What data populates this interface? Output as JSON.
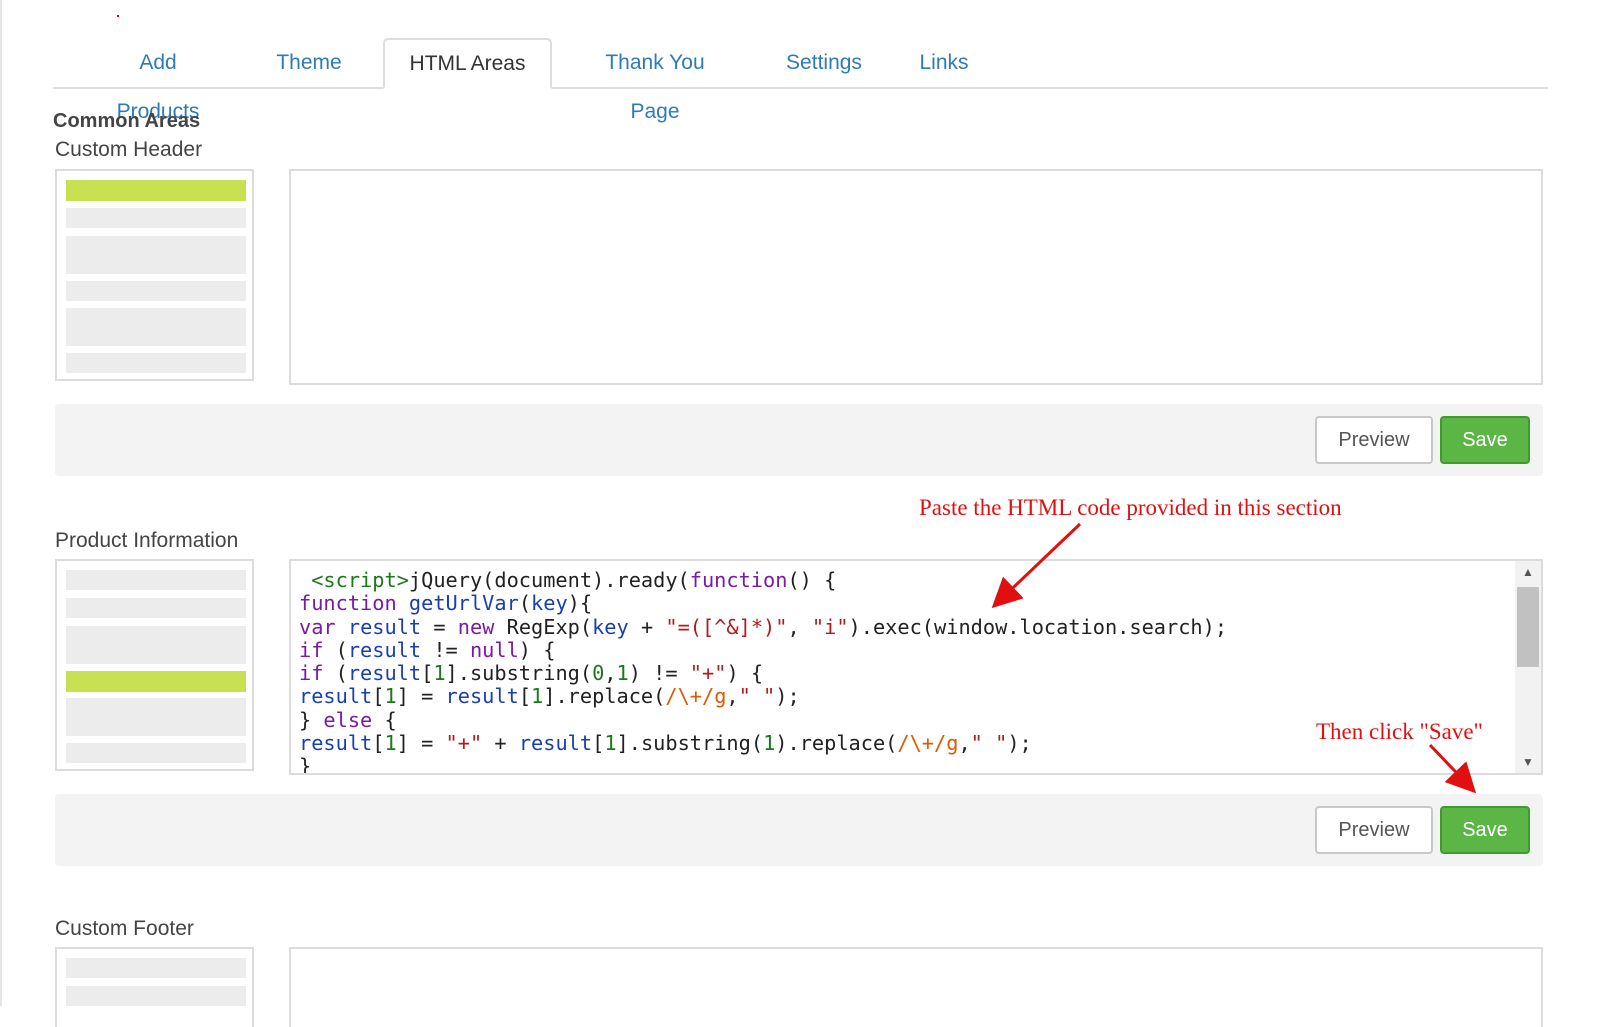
{
  "tabs": [
    {
      "label": "Add Products",
      "active": false
    },
    {
      "label": "Theme",
      "active": false
    },
    {
      "label": "HTML Areas",
      "active": true
    },
    {
      "label": "Thank You Page",
      "active": false
    },
    {
      "label": "Settings",
      "active": false
    },
    {
      "label": "Links",
      "active": false
    }
  ],
  "common_areas": {
    "heading": "Common Areas"
  },
  "custom_header": {
    "label": "Custom Header",
    "editor_value": "",
    "preview_label": "Preview",
    "save_label": "Save"
  },
  "product_information": {
    "label": "Product Information",
    "editor_lines": [
      " <script>jQuery(document).ready(function() {",
      "function getUrlVar(key){",
      "var result = new RegExp(key + \"=([^&]*)\", \"i\").exec(window.location.search);",
      "if (result != null) {",
      "if (result[1].substring(0,1) != \"+\") {",
      "result[1] = result[1].replace(/\\+/g,\" \");",
      "} else {",
      "result[1] = \"+\" + result[1].substring(1).replace(/\\+/g,\" \");",
      "}"
    ],
    "preview_label": "Preview",
    "save_label": "Save"
  },
  "custom_footer": {
    "label": "Custom Footer",
    "editor_value": ""
  },
  "annotations": {
    "paste": "Paste the HTML code provided in this section",
    "save": "Then click \"Save\""
  },
  "colors": {
    "accent_link": "#2e7ab8",
    "save_green": "#5cb646",
    "thumb_highlight": "#c8e153",
    "annotation_red": "#e01010"
  },
  "icons": {
    "scroll_up": "triangle-up-icon",
    "scroll_down": "triangle-down-icon"
  }
}
